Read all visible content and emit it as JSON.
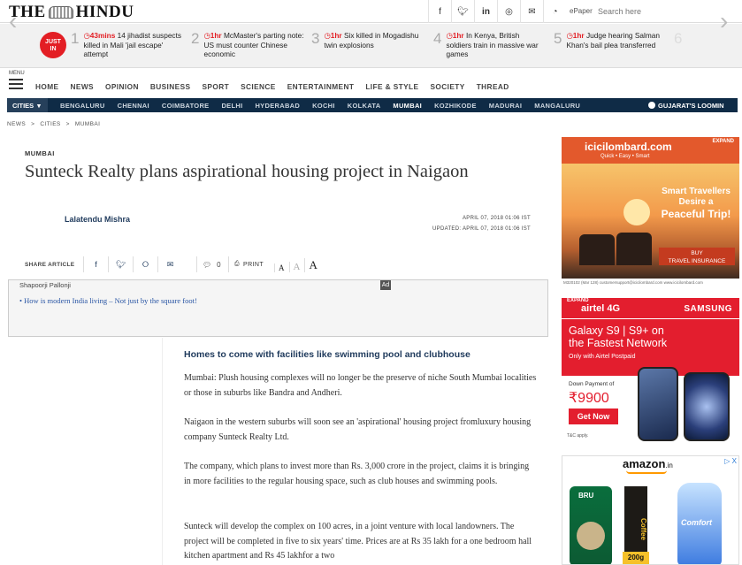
{
  "header": {
    "logo_left": "THE",
    "logo_right": "HINDU",
    "social": [
      "f",
      "t",
      "in",
      "ig",
      "mail",
      "rss"
    ],
    "epaper": "ePaper",
    "search_placeholder": "Search here"
  },
  "ticker": {
    "label_top": "JUST",
    "label_bottom": "IN",
    "items": [
      {
        "num": "1",
        "time": "43mins",
        "text": "14 jihadist suspects killed in Mali 'jail escape' attempt"
      },
      {
        "num": "2",
        "time": "1hr",
        "text": "McMaster's parting note: US must counter Chinese economic"
      },
      {
        "num": "3",
        "time": "1hr",
        "text": "Six killed in Mogadishu twin explosions"
      },
      {
        "num": "4",
        "time": "1hr",
        "text": "In Kenya, British soldiers train in massive war games"
      },
      {
        "num": "5",
        "time": "1hr",
        "text": "Judge hearing Salman Khan's bail plea transferred"
      },
      {
        "num": "6",
        "time": "",
        "text": ""
      }
    ]
  },
  "nav": {
    "menu_label": "MENU",
    "items": [
      "HOME",
      "NEWS",
      "OPINION",
      "BUSINESS",
      "SPORT",
      "SCIENCE",
      "ENTERTAINMENT",
      "LIFE & STYLE",
      "SOCIETY",
      "THREAD"
    ]
  },
  "cities": {
    "dropdown": "CITIES",
    "list": [
      "BENGALURU",
      "CHENNAI",
      "COIMBATORE",
      "DELHI",
      "HYDERABAD",
      "KOCHI",
      "KOLKATA",
      "MUMBAI",
      "KOZHIKODE",
      "MADURAI",
      "MANGALURU"
    ],
    "active": "MUMBAI",
    "promo": "GUJARAT'S LOOMIN"
  },
  "breadcrumb": [
    "NEWS",
    ">",
    "CITIES",
    ">",
    "MUMBAI"
  ],
  "article": {
    "section": "MUMBAI",
    "title": "Sunteck Realty plans aspirational housing project in Naigaon",
    "author": "Lalatendu Mishra",
    "date": "APRIL 07, 2018 01:06 IST",
    "updated": "UPDATED: APRIL 07, 2018 01:06 IST",
    "share_label": "SHARE ARTICLE",
    "comment_count": "0",
    "print_label": "PRINT",
    "sponsor": "Shapoorji Pallonji",
    "ad_badge": "Ad",
    "related_link": "How is modern India living – Not just by the square foot!",
    "subhead": "Homes to come with facilities like swimming pool and clubhouse",
    "paragraphs": [
      "Mumbai: Plush housing complexes will no longer be the preserve of niche South Mumbai localities or those in suburbs like Bandra and Andheri.",
      "Naigaon in the western suburbs will soon see an 'aspirational' housing project fromluxury housing company Sunteck Realty Ltd.",
      "The company, which plans to invest more than Rs. 3,000 crore in the project, claims it is bringing in more facilities to the regular housing space, such as club houses and swimming pools.",
      "Sunteck will develop the complex on 100 acres, in a joint venture with local landowners. The project will be completed in five to six years' time. Prices are at Rs 35 lakh for a one bedroom hall kitchen apartment and Rs 45 lakhfor a two"
    ]
  },
  "ads": {
    "icici": {
      "brand": "icicilombard.com",
      "tagline": "Quick • Easy • Smart",
      "expand": "EXPAND",
      "line1": "Smart Travellers",
      "line2": "Desire a",
      "line3": "Peaceful Trip!",
      "cta1": "BUY",
      "cta2": "TRAVEL INSURANCE",
      "footer": "M320102 (Mar 128) customersupport@icicilombard.com www.icicilombard.com"
    },
    "airtel": {
      "expand": "EXPAND",
      "brand": "airtel 4G",
      "partner": "SAMSUNG",
      "line1": "Galaxy S9 | S9+ on",
      "line2": "the Fastest Network",
      "line3": "Only with Airtel Postpaid",
      "down": "Down Payment of",
      "price": "₹9900",
      "cta": "Get Now",
      "tc": "T&C apply."
    },
    "amazon": {
      "brand": "amazon",
      "suffix": ".in",
      "close": "▷ X",
      "p1": "BRU",
      "p2": "Coffee",
      "p2w": "200g",
      "p3": "Comfort"
    }
  }
}
